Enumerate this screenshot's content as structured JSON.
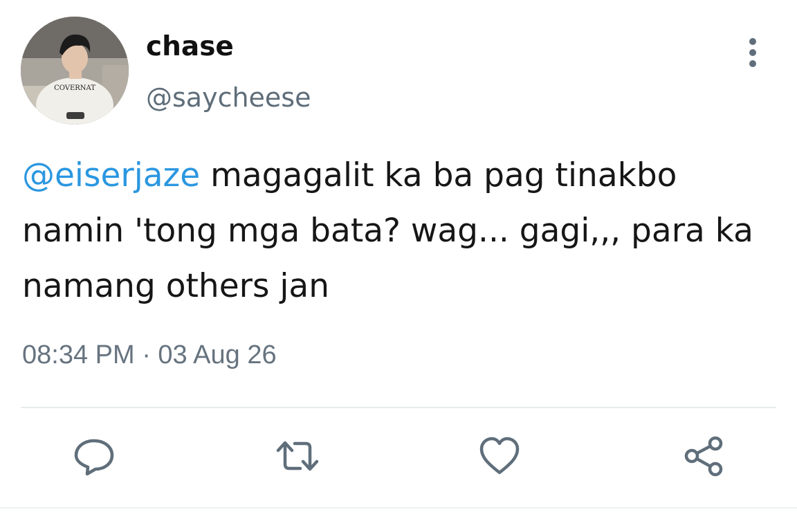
{
  "tweet": {
    "author": {
      "display_name": "chase",
      "handle": "@saycheese",
      "avatar_shirt_text": "COVERNAT"
    },
    "mention": "@eiserjaze",
    "text": " magagalit ka ba pag tinakbo namin 'tong mga bata? wag... gagi,,, para ka namang others jan",
    "timestamp": "08:34 PM · 03 Aug 26"
  },
  "actions": [
    {
      "name": "reply",
      "icon": "comment-icon"
    },
    {
      "name": "retweet",
      "icon": "retweet-icon"
    },
    {
      "name": "like",
      "icon": "heart-icon"
    },
    {
      "name": "share",
      "icon": "share-icon"
    }
  ],
  "colors": {
    "mention": "#2b97e0",
    "secondary_text": "#5e6d79",
    "icon": "#5f6e7a",
    "divider": "#e7ebee"
  }
}
